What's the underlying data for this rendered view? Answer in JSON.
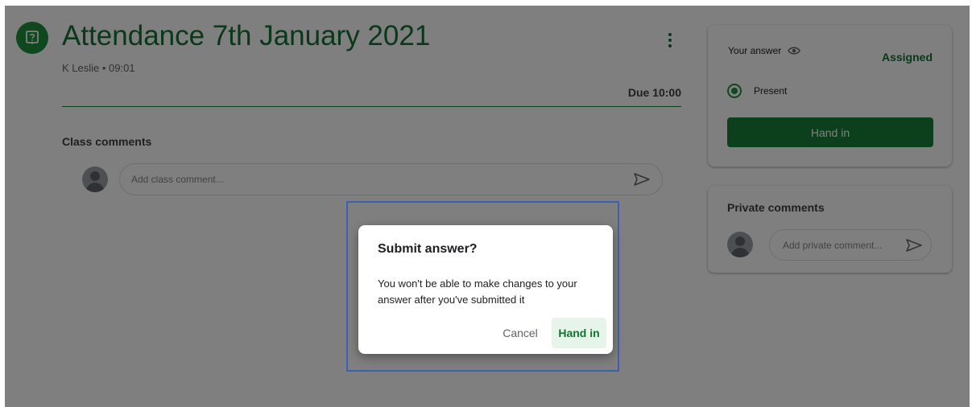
{
  "post": {
    "title": "Attendance 7th January 2021",
    "meta": "K Leslie • 09:01",
    "due": "Due 10:00",
    "icon": "question-assignment-icon"
  },
  "class_comments": {
    "label": "Class comments",
    "placeholder": "Add class comment..."
  },
  "answer_card": {
    "label": "Your answer",
    "status": "Assigned",
    "option_label": "Present",
    "hand_in_label": "Hand in"
  },
  "private_comments": {
    "label": "Private comments",
    "placeholder": "Add private comment..."
  },
  "dialog": {
    "title": "Submit answer?",
    "body": "You won't be able to make changes to your answer after you've submitted it",
    "cancel_label": "Cancel",
    "confirm_label": "Hand in"
  },
  "colors": {
    "accent": "#137333",
    "button": "#188038",
    "overlay": "rgba(0,0,0,0.5)",
    "focus_box": "#3f5fb3"
  }
}
